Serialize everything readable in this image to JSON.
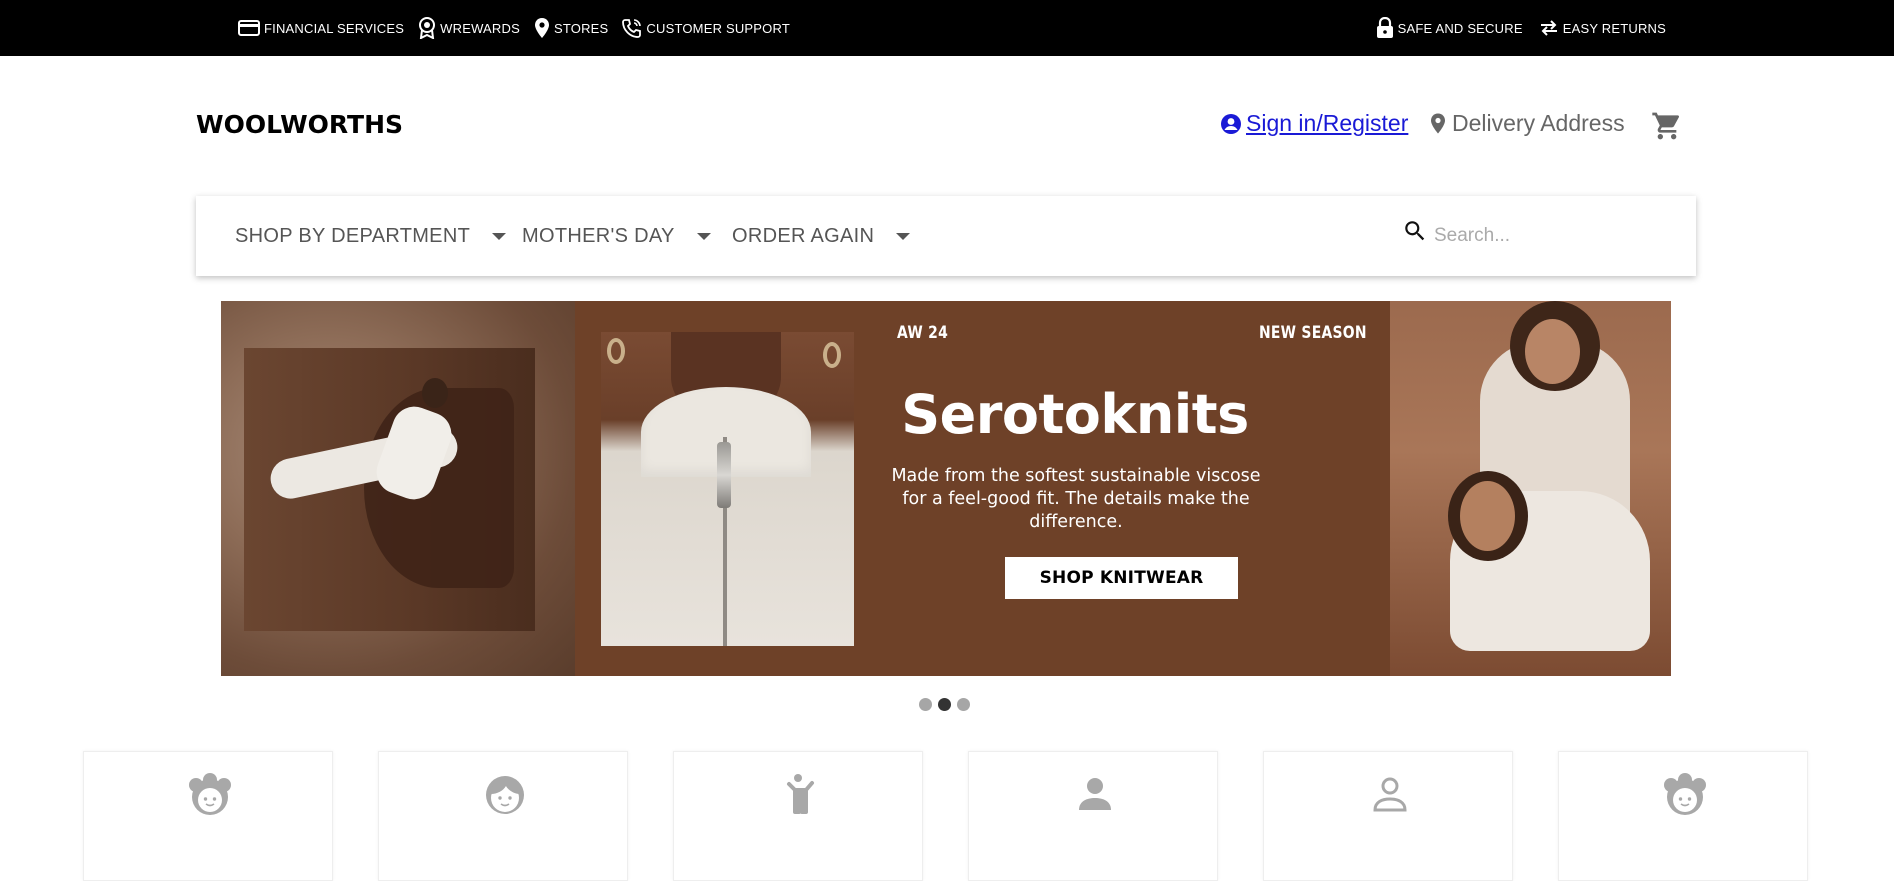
{
  "topbar": {
    "left_links": [
      {
        "label": "FINANCIAL SERVICES",
        "icon": "credit-card-icon"
      },
      {
        "label": "WREWARDS",
        "icon": "rewards-badge-icon"
      },
      {
        "label": "STORES",
        "icon": "location-pin-icon"
      },
      {
        "label": "CUSTOMER SUPPORT",
        "icon": "phone-support-icon"
      }
    ],
    "right_links": [
      {
        "label": "SAFE AND SECURE",
        "icon": "lock-icon"
      },
      {
        "label": "EASY RETURNS",
        "icon": "swap-arrows-icon"
      }
    ]
  },
  "header": {
    "logo": "WOOLWORTHS",
    "sign_in": "Sign in/Register",
    "delivery": "Delivery Address"
  },
  "nav": {
    "items": [
      {
        "label": "SHOP BY DEPARTMENT"
      },
      {
        "label": "MOTHER'S DAY"
      },
      {
        "label": "ORDER AGAIN"
      }
    ],
    "search_placeholder": "Search..."
  },
  "banner": {
    "tag_left": "AW 24",
    "tag_right": "NEW SEASON",
    "headline": "Serotoknits",
    "subtext": "Made from the softest sustainable viscose for a feel-good fit. The details make the difference.",
    "cta": "SHOP KNITWEAR",
    "slide_count": 3,
    "active_slide": 2
  },
  "categories": [
    {
      "icon": "girl-face-icon"
    },
    {
      "icon": "boy-face-icon"
    },
    {
      "icon": "child-icon"
    },
    {
      "icon": "man-icon"
    },
    {
      "icon": "woman-icon"
    },
    {
      "icon": "girl-face-icon"
    }
  ],
  "colors": {
    "topbar": "#000000",
    "link": "#1a1ad6",
    "banner_brown": "#6e4128",
    "icon_grey": "#a8a8a8"
  }
}
